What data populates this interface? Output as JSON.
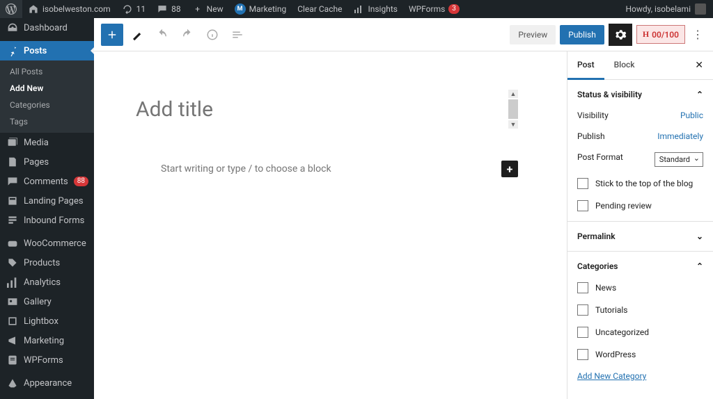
{
  "adminbar": {
    "site_name": "isobelweston.com",
    "updates_count": "11",
    "comments_count": "88",
    "new_label": "New",
    "items": [
      "Marketing",
      "Clear Cache",
      "Insights",
      "WPForms"
    ],
    "wpforms_badge": "3",
    "greeting": "Howdy, isobelami"
  },
  "sidebar": {
    "dashboard": "Dashboard",
    "posts": "Posts",
    "posts_sub": [
      "All Posts",
      "Add New",
      "Categories",
      "Tags"
    ],
    "media": "Media",
    "pages": "Pages",
    "comments": "Comments",
    "comments_badge": "88",
    "landing": "Landing Pages",
    "inbound": "Inbound Forms",
    "woo": "WooCommerce",
    "products": "Products",
    "analytics": "Analytics",
    "gallery": "Gallery",
    "lightbox": "Lightbox",
    "marketing": "Marketing",
    "wpforms": "WPForms",
    "appearance": "Appearance"
  },
  "toolbar": {
    "preview": "Preview",
    "publish": "Publish",
    "hscore": "00/100"
  },
  "editor": {
    "title_placeholder": "Add title",
    "body_placeholder": "Start writing or type / to choose a block"
  },
  "panel": {
    "tab_post": "Post",
    "tab_block": "Block",
    "status_head": "Status & visibility",
    "visibility_label": "Visibility",
    "visibility_value": "Public",
    "publish_label": "Publish",
    "publish_value": "Immediately",
    "format_label": "Post Format",
    "format_value": "Standard",
    "stick": "Stick to the top of the blog",
    "pending": "Pending review",
    "permalink": "Permalink",
    "categories_head": "Categories",
    "categories": [
      "News",
      "Tutorials",
      "Uncategorized",
      "WordPress"
    ],
    "add_category": "Add New Category"
  }
}
